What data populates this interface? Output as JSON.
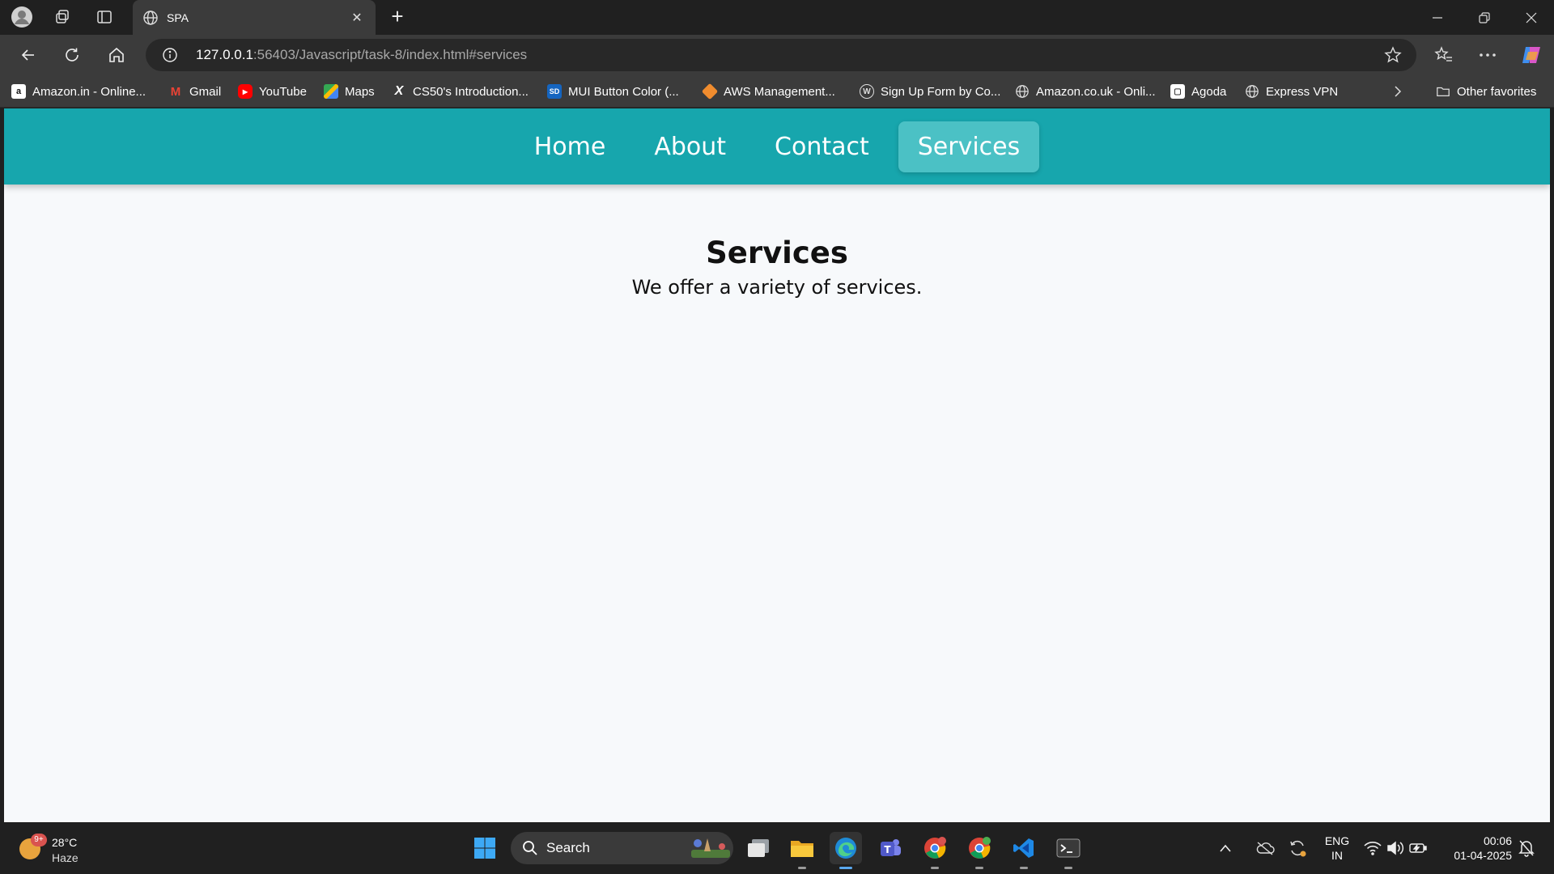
{
  "browser": {
    "tab": {
      "title": "SPA",
      "close_label": "✕"
    },
    "new_tab_label": "+",
    "address": {
      "host": "127.0.0.1",
      "path": ":56403/Javascript/task-8/index.html#services"
    },
    "bookmarks": [
      {
        "label": "Amazon.in - Online...",
        "icon": "amazon-icon"
      },
      {
        "label": "Gmail",
        "icon": "gmail-icon"
      },
      {
        "label": "YouTube",
        "icon": "youtube-icon"
      },
      {
        "label": "Maps",
        "icon": "maps-icon"
      },
      {
        "label": "CS50's Introduction...",
        "icon": "cs50-icon"
      },
      {
        "label": "MUI Button Color (...",
        "icon": "sd-icon"
      },
      {
        "label": "AWS Management...",
        "icon": "aws-icon"
      },
      {
        "label": "Sign Up Form by Co...",
        "icon": "wordpress-icon"
      },
      {
        "label": "Amazon.co.uk - Onli...",
        "icon": "globe-icon"
      },
      {
        "label": "Agoda",
        "icon": "agoda-icon"
      },
      {
        "label": "Express VPN",
        "icon": "globe-icon"
      }
    ],
    "other_favorites": "Other favorites"
  },
  "page": {
    "nav": [
      "Home",
      "About",
      "Contact",
      "Services"
    ],
    "active": "Services",
    "heading": "Services",
    "text": "We offer a variety of services."
  },
  "taskbar": {
    "weather": {
      "badge": "9+",
      "temp": "28°C",
      "condition": "Haze"
    },
    "search_label": "Search",
    "lang": {
      "line1": "ENG",
      "line2": "IN"
    },
    "clock": {
      "time": "00:06",
      "date": "01-04-2025"
    }
  },
  "colors": {
    "nav_bg": "#17a6ad",
    "nav_active": "#4bc1c5",
    "page_bg": "#f7f9fb"
  }
}
